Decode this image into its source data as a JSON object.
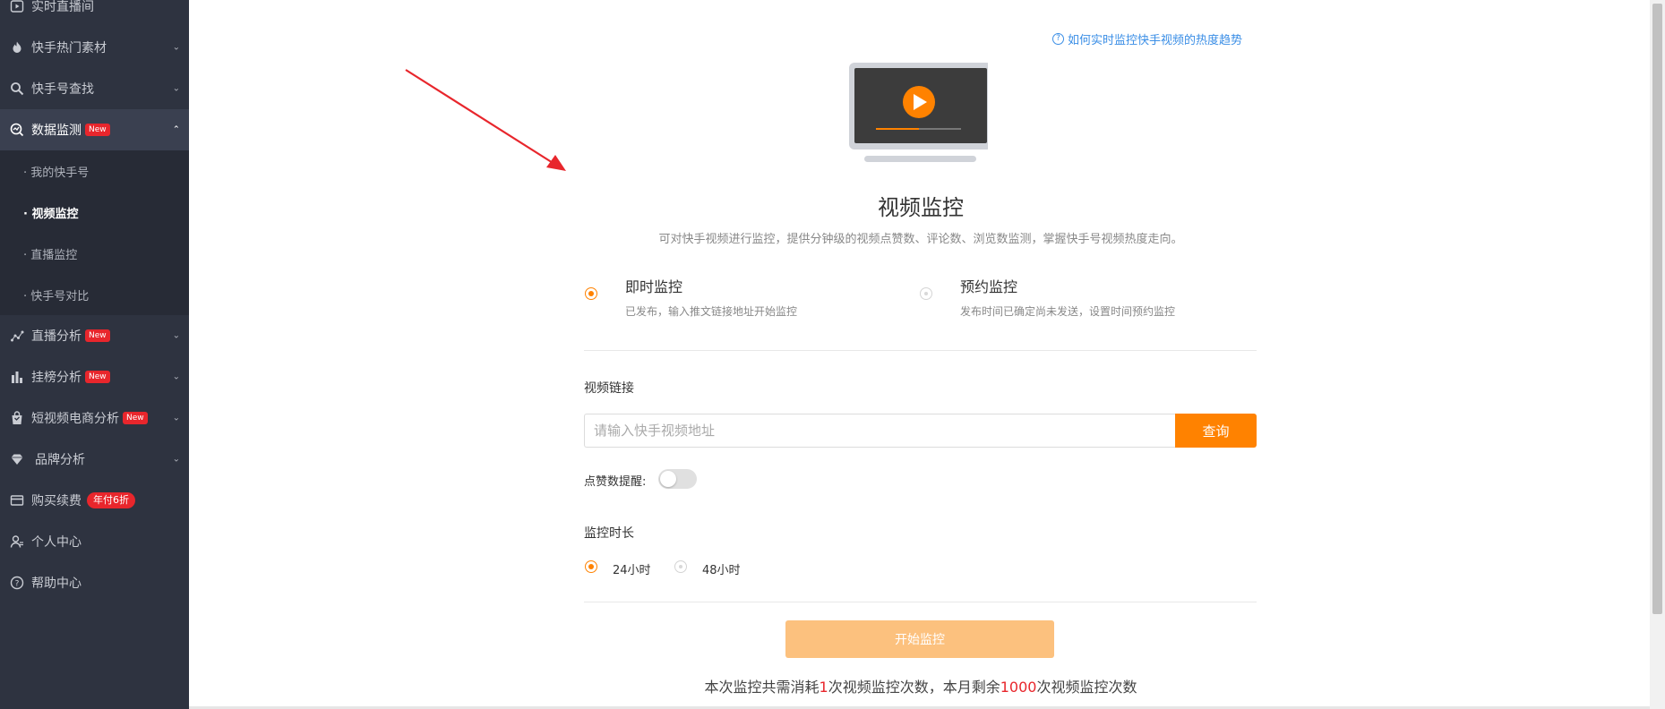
{
  "sidebar": {
    "items": [
      {
        "label": "实时直播间",
        "icon": "play-square-icon"
      },
      {
        "label": "快手热门素材",
        "icon": "flame-icon"
      },
      {
        "label": "快手号查找",
        "icon": "search-icon"
      },
      {
        "label": "数据监测",
        "icon": "monitor-chart-icon",
        "badge": "New"
      },
      {
        "label": "直播分析",
        "icon": "trend-icon",
        "badge": "New"
      },
      {
        "label": "挂榜分析",
        "icon": "bar-chart-icon",
        "badge": "New"
      },
      {
        "label": "短视频电商分析",
        "icon": "shopping-bag-icon",
        "badge": "New"
      },
      {
        "label": "品牌分析",
        "icon": "diamond-icon"
      },
      {
        "label": "购买续费",
        "icon": "card-icon",
        "badge": "年付6折"
      },
      {
        "label": "个人中心",
        "icon": "user-icon"
      },
      {
        "label": "帮助中心",
        "icon": "question-icon"
      }
    ],
    "sub_items": [
      "· 我的快手号",
      "· 视频监控",
      "· 直播监控",
      "· 快手号对比"
    ]
  },
  "main": {
    "help_link": "如何实时监控快手视频的热度趋势",
    "title": "视频监控",
    "description": "可对快手视频进行监控，提供分钟级的视频点赞数、评论数、浏览数监测，掌握快手号视频热度走向。",
    "mode_options": [
      {
        "title": "即时监控",
        "desc": "已发布，输入推文链接地址开始监控",
        "checked": true
      },
      {
        "title": "预约监控",
        "desc": "发布时间已确定尚未发送，设置时间预约监控",
        "checked": false
      }
    ],
    "link_label": "视频链接",
    "link_placeholder": "请输入快手视频地址",
    "query_button": "查询",
    "likes_alert_label": "点赞数提醒:",
    "likes_alert_on": false,
    "duration_label": "监控时长",
    "duration_options": [
      {
        "label": "24小时",
        "checked": true
      },
      {
        "label": "48小时",
        "checked": false
      }
    ],
    "start_button": "开始监控",
    "cost": {
      "prefix": "本次监控共需消耗",
      "count": "1",
      "middle": "次视频监控次数，本月剩余",
      "remaining": "1000",
      "suffix": "次视频监控次数"
    }
  },
  "colors": {
    "sidebar_bg": "#2e3340",
    "accent": "#ff8200",
    "accent_light": "#fcc17e",
    "link": "#3a8ee6",
    "badge_red": "#e8262c",
    "annotation_arrow": "#e8262c"
  }
}
